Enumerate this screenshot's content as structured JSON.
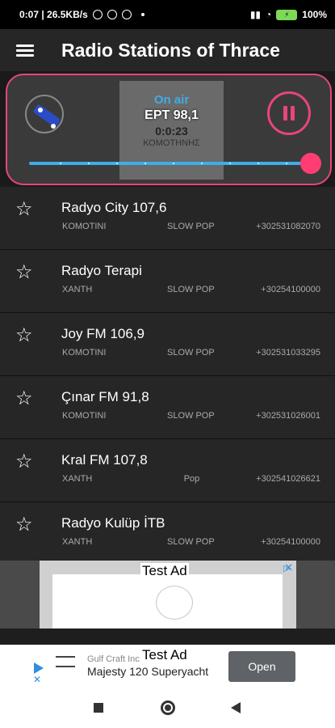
{
  "status_bar": {
    "left_text": "0:07 | 26.5KB/s",
    "battery": "100%"
  },
  "app_bar": {
    "title": "Radio Stations of Thrace",
    "menu_icon": "hamburger-menu-icon"
  },
  "player": {
    "on_air": "On air",
    "station": "EPT 98,1",
    "elapsed": "0:0:23",
    "city": "ΚΟΜΟΤΗΝΗΣ",
    "accent_color": "#e8457a",
    "progress_color": "#3daee9",
    "progress_fraction": 1.0
  },
  "stations": [
    {
      "name": "Radyo City 107,6",
      "city": "KOMOTINI",
      "genre": "SLOW POP",
      "phone": "+302531082070"
    },
    {
      "name": "Radyo Terapi",
      "city": "XANTH",
      "genre": "SLOW POP",
      "phone": "+30254100000"
    },
    {
      "name": "Joy FM 106,9",
      "city": "KOMOTINI",
      "genre": "SLOW POP",
      "phone": "+302531033295"
    },
    {
      "name": "Çınar FM 91,8",
      "city": "KOMOTINI",
      "genre": "SLOW POP",
      "phone": "+302531026001"
    },
    {
      "name": "Kral FM 107,8",
      "city": "XANTH",
      "genre": "Pop",
      "phone": "+302541026621"
    },
    {
      "name": "Radyo Kulüp İTB",
      "city": "XANTH",
      "genre": "SLOW POP",
      "phone": "+30254100000"
    }
  ],
  "ads": {
    "banner_label": "Test Ad",
    "bottom_label": "Test Ad",
    "bottom_advertiser": "Gulf Craft Inc.",
    "bottom_title": "Majesty 120 Superyacht",
    "bottom_cta": "Open"
  }
}
